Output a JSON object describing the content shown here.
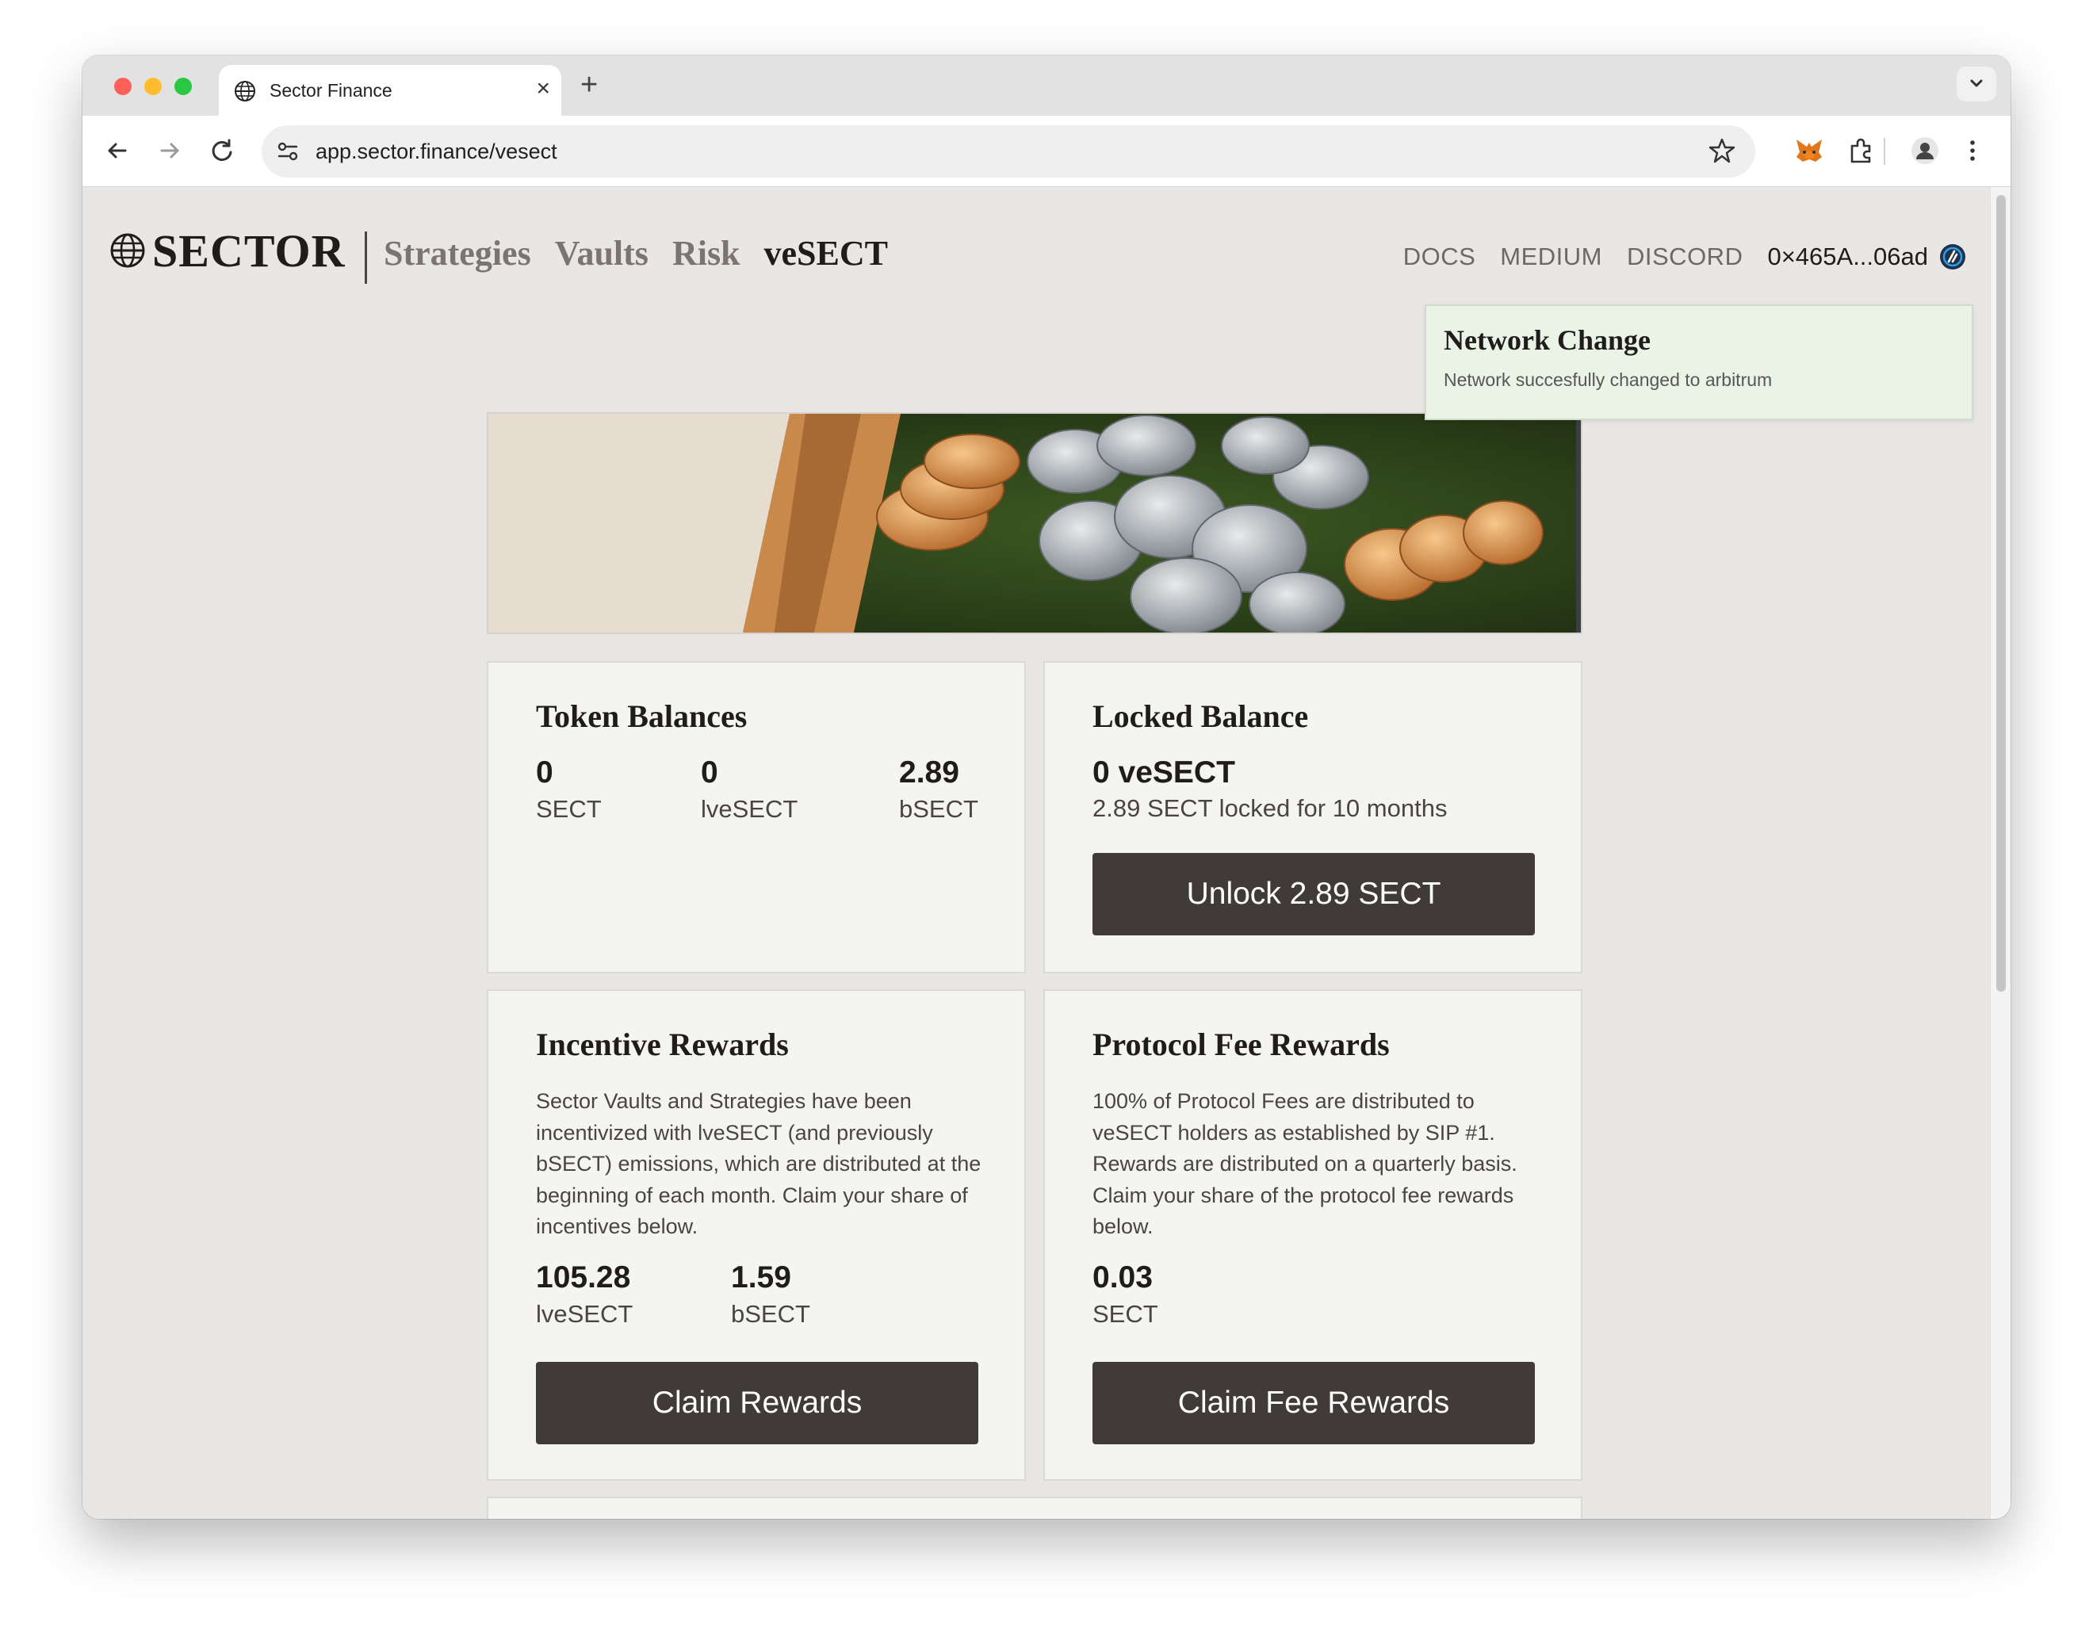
{
  "browser": {
    "tab_title": "Sector Finance",
    "url": "app.sector.finance/vesect"
  },
  "header": {
    "logo_text": "SECTOR",
    "nav": [
      {
        "label": "Strategies",
        "active": false
      },
      {
        "label": "Vaults",
        "active": false
      },
      {
        "label": "Risk",
        "active": false
      },
      {
        "label": "veSECT",
        "active": true
      }
    ],
    "links": [
      "DOCS",
      "MEDIUM",
      "DISCORD"
    ],
    "wallet": "0×465A...06ad"
  },
  "toast": {
    "title": "Network Change",
    "message": "Network succesfully changed to arbitrum"
  },
  "token_balances": {
    "title": "Token Balances",
    "items": [
      {
        "value": "0",
        "unit": "SECT"
      },
      {
        "value": "0",
        "unit": "lveSECT"
      },
      {
        "value": "2.89",
        "unit": "bSECT"
      }
    ]
  },
  "locked_balance": {
    "title": "Locked Balance",
    "amount": "0 veSECT",
    "detail": "2.89 SECT locked for 10 months",
    "button": "Unlock 2.89 SECT"
  },
  "incentive_rewards": {
    "title": "Incentive Rewards",
    "description": "Sector Vaults and Strategies have been incentivized with lveSECT (and previously bSECT) emissions, which are distributed at the beginning of each month. Claim your share of incentives below.",
    "items": [
      {
        "value": "105.28",
        "unit": "lveSECT"
      },
      {
        "value": "1.59",
        "unit": "bSECT"
      }
    ],
    "button": "Claim Rewards"
  },
  "fee_rewards": {
    "title": "Protocol Fee Rewards",
    "description": "100% of Protocol Fees are distributed to veSECT holders as established by SIP #1. Rewards are distributed on a quarterly basis. Claim your share of the protocol fee rewards below.",
    "items": [
      {
        "value": "0.03",
        "unit": "SECT"
      }
    ],
    "button": "Claim Fee Rewards"
  },
  "colors": {
    "page_bg": "#e8e7e5",
    "card_bg": "#f4f4f3",
    "button_bg": "#403b39",
    "toast_bg": "#e9f3e6",
    "text_dark": "#1f1c1a",
    "nav_muted": "#7b7470"
  },
  "icons": [
    "globe-icon",
    "close-icon",
    "plus-icon",
    "chevron-down-icon",
    "back-arrow-icon",
    "forward-arrow-icon",
    "reload-icon",
    "site-info-icon",
    "star-icon",
    "metamask-fox-icon",
    "extensions-icon",
    "profile-icon",
    "kebab-menu-icon",
    "arbitrum-chain-icon"
  ]
}
